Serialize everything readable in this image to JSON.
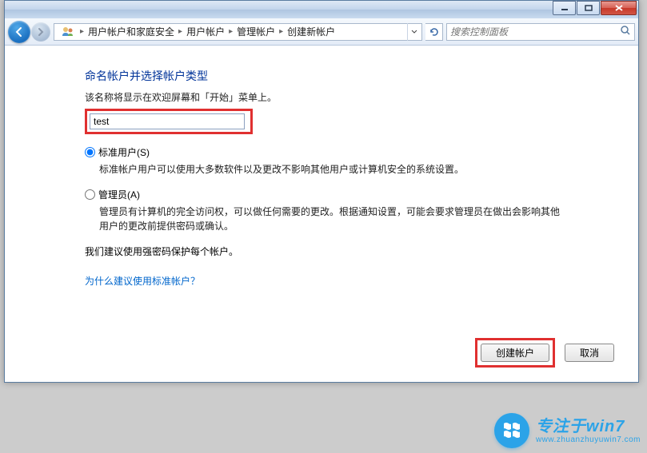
{
  "titlebar": {},
  "breadcrumb": {
    "items": [
      "用户帐户和家庭安全",
      "用户帐户",
      "管理帐户",
      "创建新帐户"
    ]
  },
  "search": {
    "placeholder": "搜索控制面板"
  },
  "page": {
    "heading": "命名帐户并选择帐户类型",
    "subtext": "该名称将显示在欢迎屏幕和「开始」菜单上。",
    "input_value": "test",
    "standard_label": "标准用户(S)",
    "standard_desc": "标准帐户用户可以使用大多数软件以及更改不影响其他用户或计算机安全的系统设置。",
    "admin_label": "管理员(A)",
    "admin_desc": "管理员有计算机的完全访问权，可以做任何需要的更改。根据通知设置，可能会要求管理员在做出会影响其他用户的更改前提供密码或确认。",
    "recommend": "我们建议使用强密码保护每个帐户。",
    "why_link": "为什么建议使用标准帐户？",
    "create_btn": "创建帐户",
    "cancel_btn": "取消"
  },
  "watermark": {
    "main": "专注于win7",
    "url": "www.zhuanzhuyuwin7.com"
  }
}
